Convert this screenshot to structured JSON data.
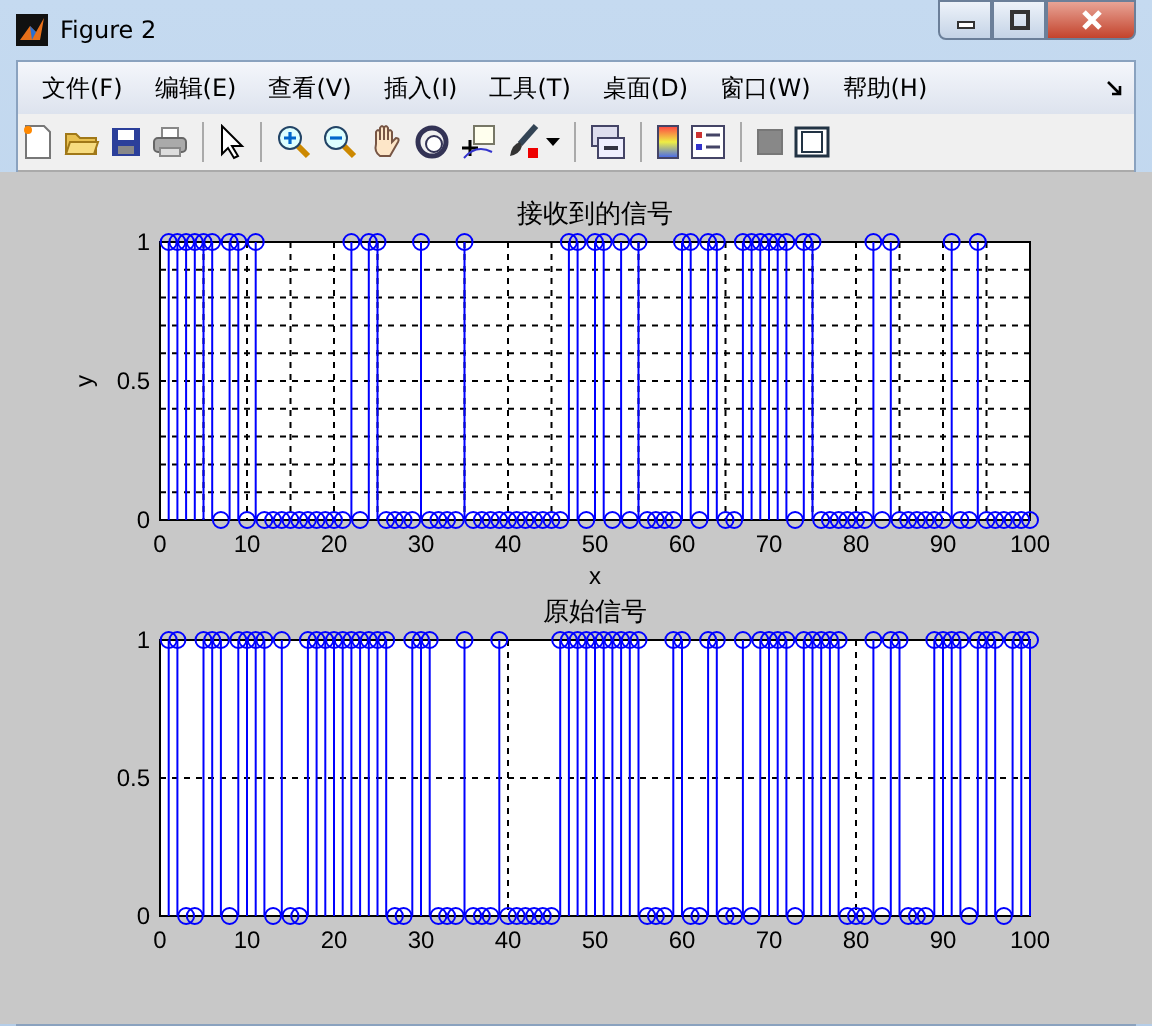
{
  "window": {
    "title": "Figure 2"
  },
  "menu": [
    "文件(F)",
    "编辑(E)",
    "查看(V)",
    "插入(I)",
    "工具(T)",
    "桌面(D)",
    "窗口(W)",
    "帮助(H)"
  ],
  "axes": [
    {
      "chart_data": {
        "grid": "minor",
        "type": "scatter",
        "title": "接收到的信号",
        "xlabel": "x",
        "ylabel": "y",
        "xlim": [
          0,
          100
        ],
        "ylim": [
          0,
          1
        ],
        "xticks": [
          0,
          10,
          20,
          30,
          40,
          50,
          60,
          70,
          80,
          90,
          100
        ],
        "yticks": [
          0,
          0.5,
          1
        ],
        "x": [
          1,
          2,
          3,
          4,
          5,
          6,
          7,
          8,
          9,
          10,
          11,
          12,
          13,
          14,
          15,
          16,
          17,
          18,
          19,
          20,
          21,
          22,
          23,
          24,
          25,
          26,
          27,
          28,
          29,
          30,
          31,
          32,
          33,
          34,
          35,
          36,
          37,
          38,
          39,
          40,
          41,
          42,
          43,
          44,
          45,
          46,
          47,
          48,
          49,
          50,
          51,
          52,
          53,
          54,
          55,
          56,
          57,
          58,
          59,
          60,
          61,
          62,
          63,
          64,
          65,
          66,
          67,
          68,
          69,
          70,
          71,
          72,
          73,
          74,
          75,
          76,
          77,
          78,
          79,
          80,
          81,
          82,
          83,
          84,
          85,
          86,
          87,
          88,
          89,
          90,
          91,
          92,
          93,
          94,
          95,
          96,
          97,
          98,
          99,
          100
        ],
        "values": [
          1,
          1,
          1,
          1,
          1,
          1,
          0,
          1,
          1,
          0,
          1,
          0,
          0,
          0,
          0,
          0,
          0,
          0,
          0,
          0,
          0,
          1,
          0,
          1,
          1,
          0,
          0,
          0,
          0,
          1,
          0,
          0,
          0,
          0,
          1,
          0,
          0,
          0,
          0,
          0,
          0,
          0,
          0,
          0,
          0,
          0,
          1,
          1,
          0,
          1,
          1,
          0,
          1,
          0,
          1,
          0,
          0,
          0,
          0,
          1,
          1,
          0,
          1,
          1,
          0,
          0,
          1,
          1,
          1,
          1,
          1,
          1,
          0,
          1,
          1,
          0,
          0,
          0,
          0,
          0,
          0,
          1,
          0,
          1,
          0,
          0,
          0,
          0,
          0,
          0,
          1,
          0,
          0,
          1,
          0,
          0,
          0,
          0,
          0,
          0
        ]
      }
    },
    {
      "chart_data": {
        "grid": "major",
        "type": "scatter",
        "title": "原始信号",
        "xlim": [
          0,
          100
        ],
        "ylim": [
          0,
          1
        ],
        "xticks": [
          0,
          10,
          20,
          30,
          40,
          50,
          60,
          70,
          80,
          90,
          100
        ],
        "yticks": [
          0,
          0.5,
          1
        ],
        "x": [
          1,
          2,
          3,
          4,
          5,
          6,
          7,
          8,
          9,
          10,
          11,
          12,
          13,
          14,
          15,
          16,
          17,
          18,
          19,
          20,
          21,
          22,
          23,
          24,
          25,
          26,
          27,
          28,
          29,
          30,
          31,
          32,
          33,
          34,
          35,
          36,
          37,
          38,
          39,
          40,
          41,
          42,
          43,
          44,
          45,
          46,
          47,
          48,
          49,
          50,
          51,
          52,
          53,
          54,
          55,
          56,
          57,
          58,
          59,
          60,
          61,
          62,
          63,
          64,
          65,
          66,
          67,
          68,
          69,
          70,
          71,
          72,
          73,
          74,
          75,
          76,
          77,
          78,
          79,
          80,
          81,
          82,
          83,
          84,
          85,
          86,
          87,
          88,
          89,
          90,
          91,
          92,
          93,
          94,
          95,
          96,
          97,
          98,
          99,
          100
        ],
        "values": [
          1,
          1,
          0,
          0,
          1,
          1,
          1,
          0,
          1,
          1,
          1,
          1,
          0,
          1,
          0,
          0,
          1,
          1,
          1,
          1,
          1,
          1,
          1,
          1,
          1,
          1,
          0,
          0,
          1,
          1,
          1,
          0,
          0,
          0,
          1,
          0,
          0,
          0,
          1,
          0,
          0,
          0,
          0,
          0,
          0,
          1,
          1,
          1,
          1,
          1,
          1,
          1,
          1,
          1,
          1,
          0,
          0,
          0,
          1,
          1,
          0,
          0,
          1,
          1,
          0,
          0,
          1,
          0,
          1,
          1,
          1,
          1,
          0,
          1,
          1,
          1,
          1,
          1,
          0,
          0,
          0,
          1,
          0,
          1,
          1,
          0,
          0,
          0,
          1,
          1,
          1,
          1,
          0,
          1,
          1,
          1,
          0,
          1,
          1,
          1
        ]
      }
    }
  ]
}
